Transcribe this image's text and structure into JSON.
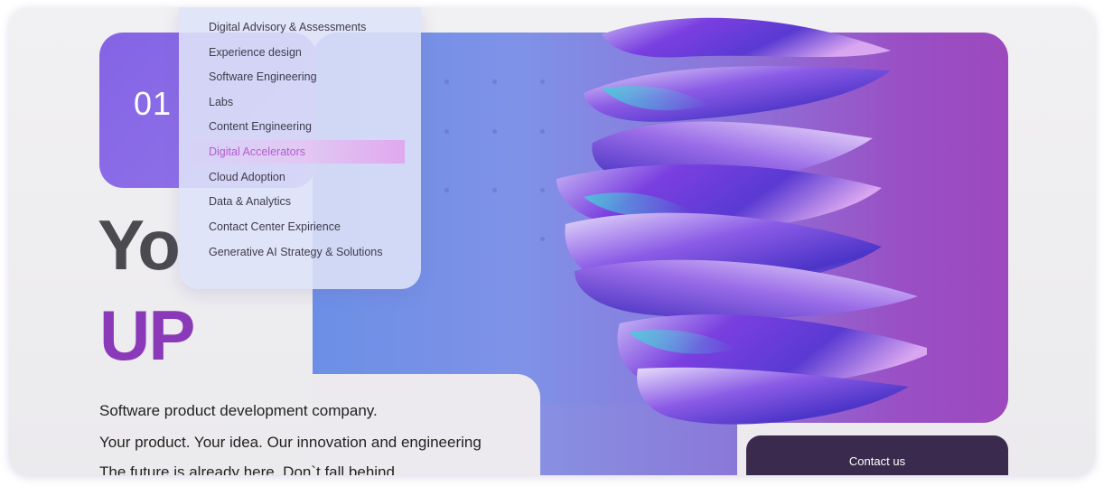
{
  "card": {
    "number": "01"
  },
  "menu": {
    "items": [
      {
        "label": "Digital Advisory & Assessments"
      },
      {
        "label": "Experience design"
      },
      {
        "label": "Software Engineering"
      },
      {
        "label": "Labs"
      },
      {
        "label": "Content Engineering"
      },
      {
        "label": "Digital Accelerators",
        "active": true
      },
      {
        "label": "Cloud Adoption"
      },
      {
        "label": "Data & Analytics"
      },
      {
        "label": "Contact Center Expirience"
      },
      {
        "label": "Generative AI Strategy & Solutions"
      }
    ]
  },
  "hero": {
    "heading_line1": "Yo",
    "heading_line2": "UP",
    "desc_line1": "Software product development company.",
    "desc_line2": "Your product. Your idea. Our innovation and engineering",
    "desc_line3": "The future is already here. Don`t fall behind"
  },
  "contact": {
    "label": "Contact us"
  },
  "colors": {
    "accent_purple": "#8a3ab8",
    "card_purple": "#8464e4",
    "contact_bg": "#3a2a4d",
    "active_menu_text": "#b45ccf"
  },
  "icons": {
    "art": "abstract-3d-ribbon-art"
  }
}
